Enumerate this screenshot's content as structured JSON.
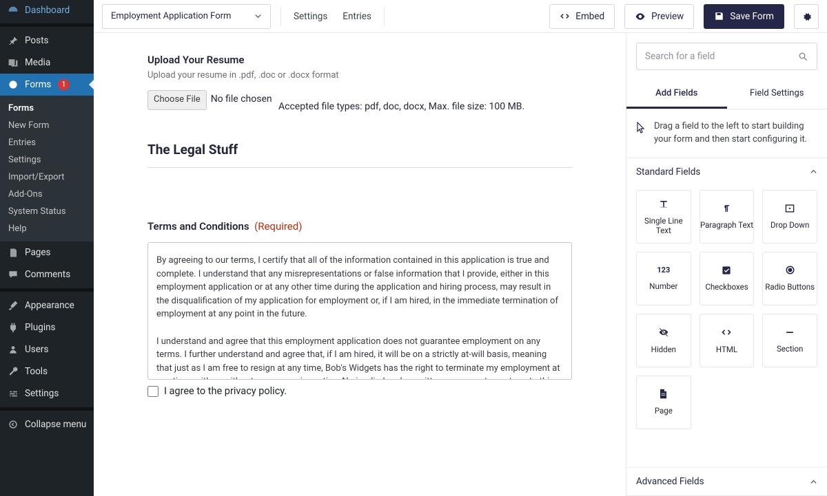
{
  "sidebar": {
    "items": [
      {
        "label": "Dashboard"
      },
      {
        "label": "Posts"
      },
      {
        "label": "Media"
      },
      {
        "label": "Forms",
        "badge": "1"
      },
      {
        "label": "Pages"
      },
      {
        "label": "Comments"
      },
      {
        "label": "Appearance"
      },
      {
        "label": "Plugins"
      },
      {
        "label": "Users"
      },
      {
        "label": "Tools"
      },
      {
        "label": "Settings"
      },
      {
        "label": "Collapse menu"
      }
    ],
    "sub": [
      "Forms",
      "New Form",
      "Entries",
      "Settings",
      "Import/Export",
      "Add-Ons",
      "System Status",
      "Help"
    ]
  },
  "topbar": {
    "form_name": "Employment Application Form",
    "settings": "Settings",
    "entries": "Entries",
    "embed": "Embed",
    "preview": "Preview",
    "save": "Save Form"
  },
  "canvas": {
    "upload": {
      "title": "Upload Your Resume",
      "desc": "Upload your resume in .pdf, .doc or .docx format",
      "choose": "Choose File",
      "no_file": "No file chosen",
      "accepted": "Accepted file types: pdf, doc, docx, Max. file size: 100 MB."
    },
    "legal_title": "The Legal Stuff",
    "terms": {
      "label": "Terms and Conditions",
      "required": "(Required)",
      "p1": "By agreeing to our terms, I certify that all of the information contained in this application is true and complete. I understand that any misrepresentations or false information that I provide, either in this employment application or at any other time during the application and hiring process, may result in the disqualification of my application for employment or, if I am hired, in the immediate termination of employment at any point in the future.",
      "p2": "I understand and agree that this employment application does not guarantee employment on any terms. I further understand and agree that, if I am hired, it will be on a strictly at-will basis, meaning that just as I am free to resign at any time, Bob's Widgets has the right to terminate my employment at any time, with or without cause or prior notice. No implied oral or written agreements contrary to this at-will employment basis are valid unless they",
      "agree": "I agree to the privacy policy."
    }
  },
  "panel": {
    "search_placeholder": "Search for a field",
    "tabs": {
      "add": "Add Fields",
      "settings": "Field Settings"
    },
    "hint": "Drag a field to the left to start building your form and then start configuring it.",
    "standard_title": "Standard Fields",
    "advanced_title": "Advanced Fields",
    "fields": {
      "single_line": "Single Line Text",
      "paragraph": "Paragraph Text",
      "dropdown": "Drop Down",
      "number": "Number",
      "checkboxes": "Checkboxes",
      "radio": "Radio Buttons",
      "hidden": "Hidden",
      "html": "HTML",
      "section": "Section",
      "page": "Page"
    }
  }
}
